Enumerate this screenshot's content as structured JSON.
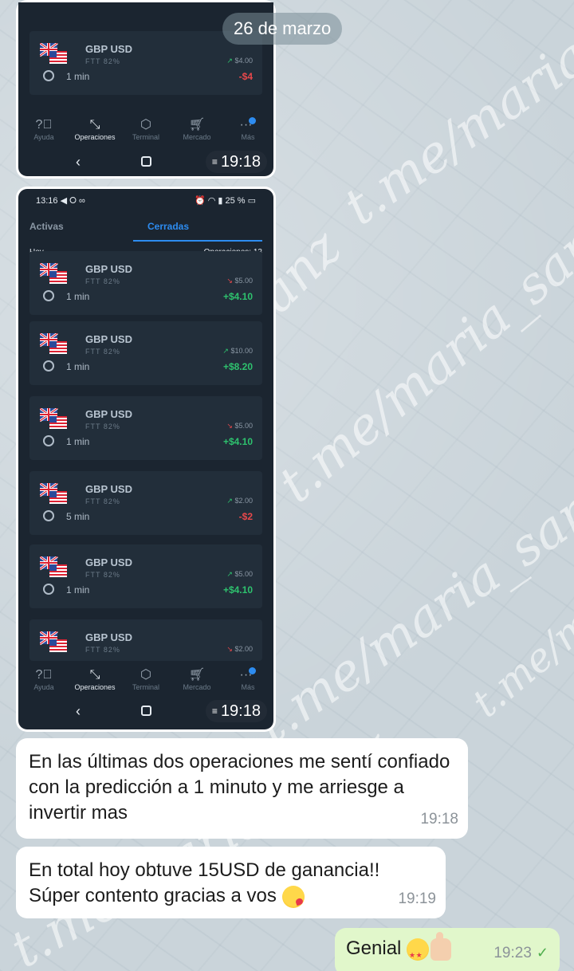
{
  "date_separator": "26 de marzo",
  "watermark": "t.me/maria_sanz",
  "screenshot_top": {
    "card": {
      "pair": "GBP USD",
      "ftt": "FTT 82%",
      "duration": "1 min",
      "investment": "$4.00",
      "direction": "up",
      "result": "-$4",
      "result_sign": "neg"
    },
    "nav": [
      {
        "label": "Ayuda",
        "icon": "help-icon"
      },
      {
        "label": "Operaciones",
        "icon": "swap-icon"
      },
      {
        "label": "Terminal",
        "icon": "terminal-icon"
      },
      {
        "label": "Mercado",
        "icon": "cart-icon"
      },
      {
        "label": "Más",
        "icon": "more-icon"
      }
    ],
    "timestamp": "19:18"
  },
  "screenshot_bottom": {
    "status_time": "13:16",
    "status_battery": "25 %",
    "tabs": {
      "active": "Activas",
      "closed": "Cerradas"
    },
    "header_left": "Hoy",
    "header_right": "Operaciones: 13",
    "cards": [
      {
        "pair": "GBP USD",
        "ftt": "FTT 82%",
        "duration": "1 min",
        "investment": "$5.00",
        "direction": "down",
        "result": "+$4.10",
        "result_sign": "pos"
      },
      {
        "pair": "GBP USD",
        "ftt": "FTT 82%",
        "duration": "1 min",
        "investment": "$10.00",
        "direction": "up",
        "result": "+$8.20",
        "result_sign": "pos"
      },
      {
        "pair": "GBP USD",
        "ftt": "FTT 82%",
        "duration": "1 min",
        "investment": "$5.00",
        "direction": "down",
        "result": "+$4.10",
        "result_sign": "pos"
      },
      {
        "pair": "GBP USD",
        "ftt": "FTT 82%",
        "duration": "5 min",
        "investment": "$2.00",
        "direction": "up",
        "result": "-$2",
        "result_sign": "neg"
      },
      {
        "pair": "GBP USD",
        "ftt": "FTT 82%",
        "duration": "1 min",
        "investment": "$5.00",
        "direction": "up",
        "result": "+$4.10",
        "result_sign": "pos"
      },
      {
        "pair": "GBP USD",
        "ftt": "FTT 82%",
        "duration": "",
        "investment": "$2.00",
        "direction": "down",
        "result": "",
        "result_sign": "pos"
      }
    ],
    "nav": [
      {
        "label": "Ayuda",
        "icon": "help-icon"
      },
      {
        "label": "Operaciones",
        "icon": "swap-icon"
      },
      {
        "label": "Terminal",
        "icon": "terminal-icon"
      },
      {
        "label": "Mercado",
        "icon": "cart-icon"
      },
      {
        "label": "Más",
        "icon": "more-icon"
      }
    ],
    "timestamp": "19:18"
  },
  "messages": [
    {
      "text": "En las últimas dos operaciones me sentí confiado con la predicción a 1 minuto y me arriesge a invertir mas",
      "time": "19:18",
      "direction": "in"
    },
    {
      "text": "En total hoy obtuve 15USD de ganancia!! Súper contento gracias a vos",
      "emoji": "kissing-face-emoji",
      "time": "19:19",
      "direction": "in"
    },
    {
      "text": "Genial",
      "emoji": "star-struck-emoji thumbs-up-emoji",
      "time": "19:23",
      "direction": "out",
      "status": "sent-check"
    }
  ]
}
